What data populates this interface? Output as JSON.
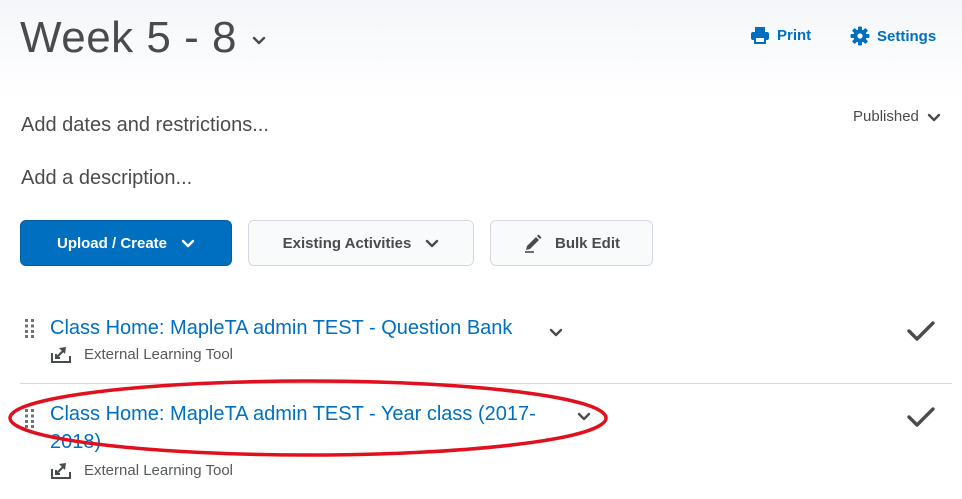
{
  "header": {
    "title": "Week 5 - 8",
    "print_label": "Print",
    "settings_label": "Settings"
  },
  "status": {
    "label": "Published"
  },
  "placeholders": {
    "add_dates": "Add dates and restrictions...",
    "add_description": "Add a description..."
  },
  "toolbar": {
    "upload_label": "Upload / Create",
    "existing_label": "Existing Activities",
    "bulk_label": "Bulk Edit"
  },
  "items": [
    {
      "title": "Class Home: MapleTA admin TEST - Question Bank",
      "type": "External Learning Tool",
      "completed": true
    },
    {
      "title": "Class Home: MapleTA admin TEST - Year class (2017-2018)",
      "type": "External Learning Tool",
      "completed": true,
      "highlighted": true
    }
  ],
  "colors": {
    "accent": "#006fbf",
    "annotation": "#e0101f",
    "text_muted": "#494c4e"
  },
  "icons": [
    "chevron-down-icon",
    "print-icon",
    "gear-icon",
    "pencil-icon",
    "drag-handle-icon",
    "external-tool-icon",
    "checkmark-icon"
  ]
}
